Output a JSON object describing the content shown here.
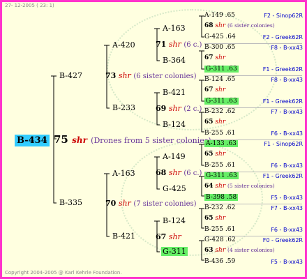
{
  "header": {
    "date": "27- 12-2005 ( 23: 1)"
  },
  "footer": {
    "copyright": "Copyright 2004-2005 @ Karl Kehrle Foundation."
  },
  "root": {
    "label": "B-434",
    "year": "75",
    "shr": "shr",
    "note": "(Drones from 5 sister colonies)"
  },
  "gen1": [
    {
      "label": "B-427"
    },
    {
      "label": "B-335"
    }
  ],
  "gen2": [
    {
      "label": "A-420"
    },
    {
      "label": "73",
      "shr": "shr",
      "note": "(6 sister colonies)"
    },
    {
      "label": "B-233"
    },
    {
      "label": "A-163"
    },
    {
      "label": "70",
      "shr": "shr",
      "note": "(7 sister colonies)"
    },
    {
      "label": "B-421"
    }
  ],
  "gen3": [
    {
      "label": "A-163"
    },
    {
      "label": "71",
      "shr": "shr",
      "note": "(6 c.)"
    },
    {
      "label": "B-364"
    },
    {
      "label": "B-421"
    },
    {
      "label": "69",
      "shr": "shr",
      "note": "(2 c.)"
    },
    {
      "label": "B-124"
    },
    {
      "label": "A-149"
    },
    {
      "label": "68",
      "shr": "shr",
      "note": "(6 c.)"
    },
    {
      "label": "G-425"
    },
    {
      "label": "B-124"
    },
    {
      "label": "67",
      "shr": "shr"
    },
    {
      "label": "G-311"
    }
  ],
  "gen4": [
    {
      "label": "A-149 .65",
      "right": "F2 - Sinop62R"
    },
    {
      "label": "68",
      "shr": "shr",
      "note": "(6 sister colonies)"
    },
    {
      "label": "G-425 .64",
      "right": "F2 - Greek62R"
    },
    {
      "label": "B-300 .65",
      "right": "F8 - B-xx43"
    },
    {
      "label": "67",
      "shr": "shr"
    },
    {
      "label": "G-311 .63",
      "right": "F1 - Greek62R"
    },
    {
      "label": "B-124 .65",
      "right": "F8 - B-xx43"
    },
    {
      "label": "67",
      "shr": "shr"
    },
    {
      "label": "G-311 .63",
      "right": "F1 - Greek62R"
    },
    {
      "label": "B-232 .62",
      "right": "F7 - B-xx43"
    },
    {
      "label": "65",
      "shr": "shr"
    },
    {
      "label": "B-255 .61",
      "right": "F6 - B-xx43"
    },
    {
      "label": "A-133 .63",
      "right": "F1 - Sinop62R"
    },
    {
      "label": "65",
      "shr": "shr"
    },
    {
      "label": "B-255 .61",
      "right": "F6 - B-xx43"
    },
    {
      "label": "G-311 .63",
      "right": "F1 - Greek62R"
    },
    {
      "label": "64",
      "shr": "shr",
      "note": "(5 sister colonies)"
    },
    {
      "label": "B-398 .58",
      "right": "F5 - B-xx43"
    },
    {
      "label": "B-232 .62",
      "right": "F7 - B-xx43"
    },
    {
      "label": "65",
      "shr": "shr"
    },
    {
      "label": "B-255 .61",
      "right": "F6 - B-xx43"
    },
    {
      "label": "G-428 .62",
      "right": "F0 - Greek62R"
    },
    {
      "label": "63",
      "shr": "shr",
      "note": "(4 sister colonies)"
    },
    {
      "label": "B-436 .59",
      "right": "F5 - B-xx43"
    }
  ],
  "colors": {
    "frame": "#ff33cc",
    "background": "#ffffe0",
    "root": "#33ccff",
    "highlight": "#66ee66",
    "shr": "#cc0000",
    "note": "#663399",
    "right": "#0000cc"
  }
}
